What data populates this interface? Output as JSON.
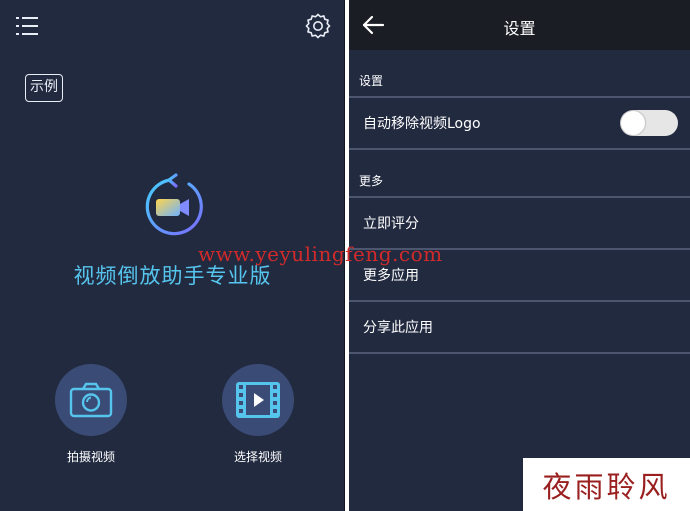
{
  "left": {
    "icons": {
      "menu": "list-menu-icon",
      "settings": "gear-icon",
      "logo": "video-reverse-logo-icon"
    },
    "example_label": "示例",
    "app_title": "视频倒放助手专业版",
    "actions": [
      {
        "label": "拍摄视频",
        "icon": "camera-icon"
      },
      {
        "label": "选择视频",
        "icon": "film-play-icon"
      }
    ]
  },
  "right": {
    "topbar": {
      "title": "设置",
      "back_icon": "arrow-left-icon"
    },
    "sections": [
      {
        "header": "设置",
        "rows": [
          {
            "label": "自动移除视频Logo",
            "toggle": false
          }
        ]
      },
      {
        "header": "更多",
        "rows": [
          {
            "label": "立即评分"
          },
          {
            "label": "更多应用"
          },
          {
            "label": "分享此应用"
          }
        ]
      }
    ]
  },
  "overlay": {
    "watermark": "www.yeyulingfeng.com",
    "brand": "夜雨聆风"
  },
  "colors": {
    "panel_bg": "#222a40",
    "topbar_bg": "#1a1d24",
    "accent": "#56c5ee",
    "watermark": "#d22a2a",
    "brand": "#9a1f1f"
  }
}
